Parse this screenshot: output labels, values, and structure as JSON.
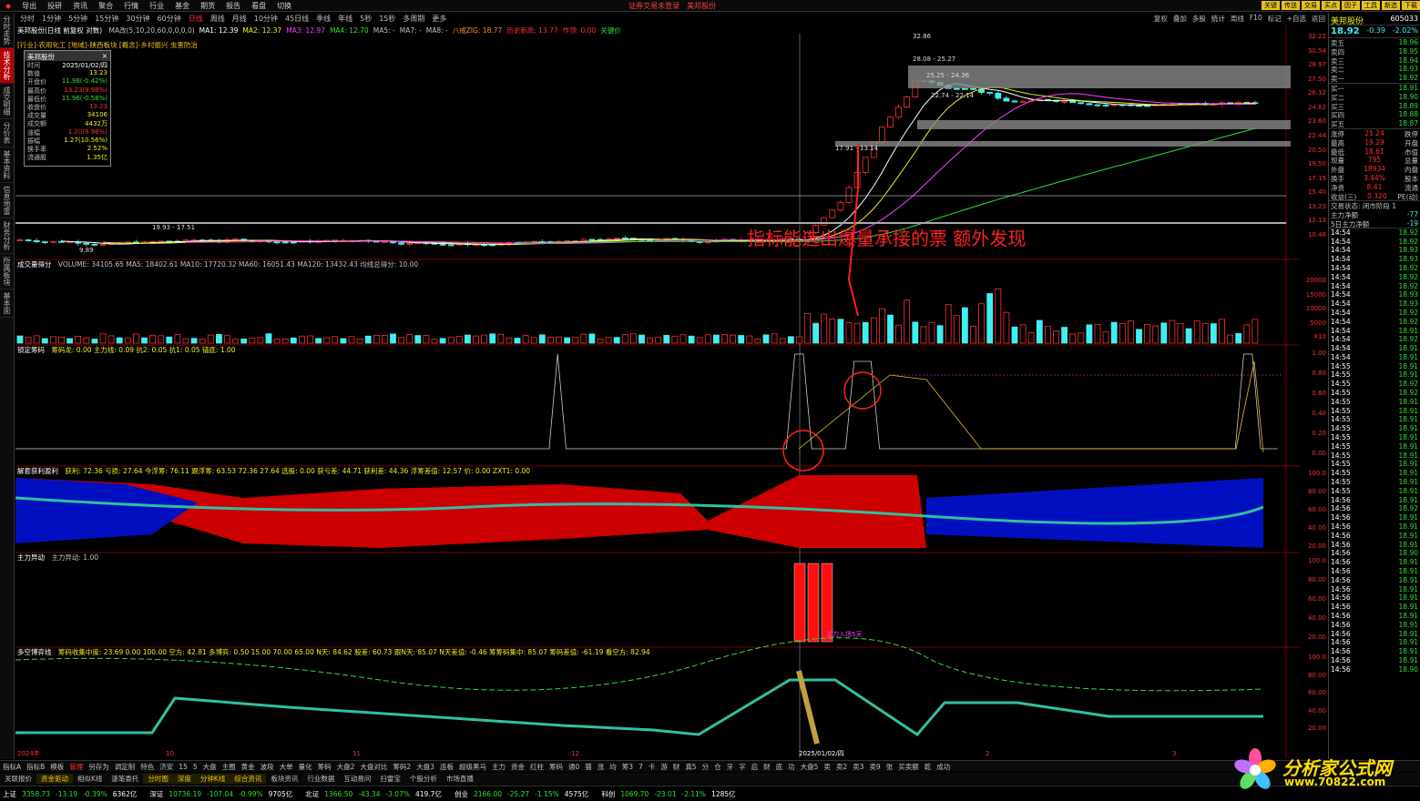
{
  "menu": {
    "items": [
      "导出",
      "投研",
      "资讯",
      "聚合",
      "行情",
      "行业",
      "基金",
      "期货",
      "报告",
      "看盘",
      "切换"
    ],
    "notice": [
      "证券交易未登录",
      "美邦股份"
    ],
    "right_buttons": [
      "关键",
      "传送",
      "交易",
      "买点",
      "因子",
      "工具",
      "新选",
      "下载"
    ]
  },
  "periods": {
    "items": [
      "分时",
      "1分钟",
      "5分钟",
      "15分钟",
      "30分钟",
      "60分钟",
      "日线",
      "周线",
      "月线",
      "10分钟",
      "45日线",
      "季线",
      "年线",
      "5秒",
      "15秒",
      "多周期",
      "更多"
    ],
    "active_index": 6,
    "tools": [
      "复权",
      "叠加",
      "多股",
      "统计",
      "周线",
      "F10",
      "标记",
      "+自选",
      "返回"
    ]
  },
  "leftbar": {
    "items": [
      "分时走势",
      "技术分析",
      "成交明细",
      "分价表",
      "基本资料",
      "信息地雷",
      "财务分析",
      "所属板块",
      "基本面"
    ],
    "active_index": 1
  },
  "stock": {
    "name": "美邦股份",
    "code": "605033",
    "price": "18.92",
    "change": "-0.39",
    "change_pct": "-2.02%"
  },
  "pane1": {
    "title": "美邦股份(日线 前复权 对数)",
    "ma_legend": [
      {
        "text": "MA改(5,10,20,60,0,0,0,0)",
        "color": "#c0c0c0"
      },
      {
        "text": "MA1: 12.39",
        "color": "#ffffff"
      },
      {
        "text": "MA2: 12.37",
        "color": "#f0f020"
      },
      {
        "text": "MA3: 12.97",
        "color": "#ff40ff"
      },
      {
        "text": "MA4: 12.70",
        "color": "#30e030"
      },
      {
        "text": "MA5: -",
        "color": "#c0c0c0"
      },
      {
        "text": "MA7: -",
        "color": "#c0c0c0"
      },
      {
        "text": "MA8: -",
        "color": "#c0c0c0"
      },
      {
        "text": "八戒ZIG: 18.77",
        "color": "#ff9020"
      },
      {
        "text": "历史新高: 13.77",
        "color": "#ff3030"
      },
      {
        "text": "作顶: 0.00",
        "color": "#ff3030"
      },
      {
        "text": "关键价",
        "color": "#30e030"
      }
    ],
    "sector": "[行业]-农用化工 [地域]-陕西板块 [概念]-乡村振兴 虫害防治",
    "price_labels": [
      "32.86",
      "28.08 - 25.27",
      "25.25 - 24.36",
      "22.74 - 22.14",
      "17.91 - 13.14",
      "19.93 - 17.51",
      "9.89"
    ],
    "axis": [
      "32.22",
      "30.54",
      "28.97",
      "27.50",
      "26.12",
      "24.82",
      "23.60",
      "22.44",
      "20.50",
      "19.50",
      "17.15",
      "15.40",
      "13.23",
      "12.13",
      "10.46"
    ],
    "annotation": "指标能选出爆量承接的票 额外发现",
    "markers": [
      "高点",
      "高点",
      "高点",
      "低点",
      "关键价"
    ]
  },
  "infobox": {
    "title": "美邦股份",
    "rows": [
      {
        "k": "时间",
        "v": "2025/01/02/四",
        "c": "#ffffff"
      },
      {
        "k": "数值",
        "v": "13.23",
        "c": "#f0f020"
      },
      {
        "k": "开盘价",
        "v": "11.98(-0.42%)",
        "c": "#30e030"
      },
      {
        "k": "最高价",
        "v": "13.23(9.98%)",
        "c": "#ff3030"
      },
      {
        "k": "最低价",
        "v": "11.96(-0.58%)",
        "c": "#30e030"
      },
      {
        "k": "收盘价",
        "v": "13.23",
        "c": "#ff3030"
      },
      {
        "k": "成交量",
        "v": "34106",
        "c": "#f0f020"
      },
      {
        "k": "成交额",
        "v": "4432万",
        "c": "#f0f020"
      },
      {
        "k": "涨幅",
        "v": "1.20(9.98%)",
        "c": "#ff3030"
      },
      {
        "k": "振幅",
        "v": "1.27(10.56%)",
        "c": "#f0f020"
      },
      {
        "k": "换手率",
        "v": "2.52%",
        "c": "#f0f020"
      },
      {
        "k": "流通股",
        "v": "1.35亿",
        "c": "#f0f020"
      }
    ]
  },
  "pane2": {
    "title": "成交量得分",
    "legend": "VOLUME: 34105.65  MA5: 18402.61  MA10: 17720.32  MA60: 16051.43  MA120: 13432.43  均线总得分: 10.00",
    "axis": [
      "20000",
      "15000",
      "10000",
      "5000",
      "X10"
    ]
  },
  "pane3": {
    "title": "锁定筹码",
    "legend": "筹码龙: 0.00  主力线: 0.09  抗2: 0.05  抗1: 0.05  锚底: 1.00",
    "axis": [
      "1.00",
      "0.80",
      "0.60",
      "0.40",
      "0.20",
      "0.00"
    ]
  },
  "pane4": {
    "title": "解套获利盈利",
    "legend": "获利: 72.36  亏损: 27.64  今浮筹: 76.11  跟浮筹: 63.53  72.36  27.64  选股: 0.00  获亏差: 44.71  获利差: 44.36  浮筹差值: 12.57  价: 0.00  ZXT1: 0.00",
    "axis": [
      "100.0",
      "80.00",
      "60.00",
      "40.00",
      "20.00"
    ]
  },
  "pane5": {
    "title": "主力异动",
    "legend": "主力异动: 1.00",
    "note": "主力入场5天",
    "axis": [
      "100.0",
      "80.00",
      "60.00",
      "40.00",
      "20.00"
    ]
  },
  "pane6": {
    "title": "多空博弈线",
    "legend": "筹码收集中度: 23.69  0.00  100.00  空方: 42.81  多博弈: 0.50  15.00  70.00  65.00  N天: 84.62  股差: 60.73  跟N天: 85.07  N天差值: -0.46  筹筹码集中: 85.07  筹码差值: -61.19  看空方: 82.94",
    "axis": [
      "100.0",
      "80.00",
      "60.00",
      "40.00",
      "20.00"
    ],
    "xaxis": [
      "2024年",
      "10",
      "11",
      "12",
      "2025/01/02/四",
      "2",
      "3"
    ]
  },
  "quote": {
    "sell": [
      {
        "k": "卖五",
        "p": "18.96",
        "v": ""
      },
      {
        "k": "卖四",
        "p": "18.95",
        "v": ""
      },
      {
        "k": "卖三",
        "p": "18.94",
        "v": ""
      },
      {
        "k": "卖二",
        "p": "18.93",
        "v": ""
      },
      {
        "k": "卖一",
        "p": "18.92",
        "v": ""
      }
    ],
    "buy": [
      {
        "k": "买一",
        "p": "18.91",
        "v": ""
      },
      {
        "k": "买二",
        "p": "18.90",
        "v": ""
      },
      {
        "k": "买三",
        "p": "18.89",
        "v": ""
      },
      {
        "k": "买四",
        "p": "18.88",
        "v": ""
      },
      {
        "k": "买五",
        "p": "18.87",
        "v": ""
      }
    ],
    "stats": [
      {
        "k": "涨停",
        "v": "21.24",
        "k2": "跌停"
      },
      {
        "k": "最高",
        "v": "19.29",
        "k2": "开盘"
      },
      {
        "k": "最低",
        "v": "18.61",
        "k2": "市值"
      },
      {
        "k": "现量",
        "v": "795",
        "k2": "总量"
      },
      {
        "k": "外盘",
        "v": "18934",
        "k2": "内盘"
      },
      {
        "k": "换手",
        "v": "3.44%",
        "k2": "股本"
      },
      {
        "k": "净资",
        "v": "8.41",
        "k2": "流通"
      },
      {
        "k": "收益(三)",
        "v": "0.320",
        "k2": "PE(动)"
      }
    ],
    "status": "交易状态: 闭市阶段 1",
    "flow1": {
      "k": "主力净额",
      "v": "-77"
    },
    "flow2": {
      "k": "5日主力净额",
      "v": "-19"
    },
    "ticks": [
      [
        "14:54",
        "18.92"
      ],
      [
        "14:54",
        "18.92"
      ],
      [
        "14:54",
        "18.93"
      ],
      [
        "14:54",
        "18.93"
      ],
      [
        "14:54",
        "18.92"
      ],
      [
        "14:54",
        "18.92"
      ],
      [
        "14:54",
        "18.92"
      ],
      [
        "14:54",
        "18.93"
      ],
      [
        "14:54",
        "18.93"
      ],
      [
        "14:54",
        "18.92"
      ],
      [
        "14:54",
        "18.92"
      ],
      [
        "14:54",
        "18.91"
      ],
      [
        "14:54",
        "18.92"
      ],
      [
        "14:54",
        "18.91"
      ],
      [
        "14:54",
        "18.91"
      ],
      [
        "14:55",
        "18.91"
      ],
      [
        "14:55",
        "18.91"
      ],
      [
        "14:55",
        "18.92"
      ],
      [
        "14:55",
        "18.92"
      ],
      [
        "14:55",
        "18.91"
      ],
      [
        "14:55",
        "18.91"
      ],
      [
        "14:55",
        "18.91"
      ],
      [
        "14:55",
        "18.91"
      ],
      [
        "14:55",
        "18.91"
      ],
      [
        "14:55",
        "18.91"
      ],
      [
        "14:55",
        "18.91"
      ],
      [
        "14:55",
        "18.91"
      ],
      [
        "14:55",
        "18.91"
      ],
      [
        "14:55",
        "18.91"
      ],
      [
        "14:55",
        "18.91"
      ],
      [
        "14:56",
        "18.91"
      ],
      [
        "14:56",
        "18.92"
      ],
      [
        "14:56",
        "18.91"
      ],
      [
        "14:56",
        "18.91"
      ],
      [
        "14:56",
        "18.91"
      ],
      [
        "14:56",
        "18.91"
      ],
      [
        "14:56",
        "18.90"
      ],
      [
        "14:56",
        "18.91"
      ],
      [
        "14:56",
        "18.91"
      ],
      [
        "14:56",
        "18.91"
      ],
      [
        "14:56",
        "18.91"
      ],
      [
        "14:56",
        "18.91"
      ],
      [
        "14:56",
        "18.91"
      ],
      [
        "14:56",
        "18.91"
      ],
      [
        "14:56",
        "18.91"
      ],
      [
        "14:56",
        "18.91"
      ],
      [
        "14:56",
        "18.91"
      ],
      [
        "14:56",
        "18.91"
      ],
      [
        "14:56",
        "18.91"
      ],
      [
        "14:56",
        "18.90"
      ]
    ]
  },
  "bottom_tabs": [
    "指标A",
    "指标B",
    "模板",
    "管理",
    "另存为",
    "调定制",
    "特色",
    "济安",
    "15",
    "5",
    "大盘",
    "主圈",
    "黄金",
    "波段",
    "大单",
    "量化",
    "筹码",
    "大盘2",
    "大盘对比",
    "筹码2",
    "大盘3",
    "连板",
    "超级黑马",
    "主力",
    "资金",
    "红柱",
    "筹码",
    "通0",
    "猫",
    "涨",
    "均",
    "筹3",
    "7",
    "卡",
    "游",
    "财",
    "真5",
    "分",
    "仓",
    "牙",
    "字",
    "启",
    "财",
    "底",
    "功",
    "大盘5",
    "卖",
    "卖2",
    "卖3",
    "卖9",
    "张",
    "买卖额",
    "乾",
    "成功"
  ],
  "bottom_tabs_active": 3,
  "bottom_tabs2": [
    "关联报价",
    "资金驱动",
    "相似K线",
    "逐笔委托",
    "分时图",
    "深度",
    "分钟K线",
    "综合资讯",
    "板块资讯",
    "行业数据",
    "互动易问",
    "扫雷宝",
    "个股分析",
    "市场直播"
  ],
  "bottom_tabs2_hl": [
    1,
    4,
    5,
    6,
    7
  ],
  "status_indices": [
    {
      "name": "上证",
      "val": "3358.73",
      "chg": "-13.19",
      "pct": "-0.39%",
      "amt": "6362亿"
    },
    {
      "name": "深证",
      "val": "10736.19",
      "chg": "-107.04",
      "pct": "-0.99%",
      "amt": "9705亿"
    },
    {
      "name": "北证",
      "val": "1366.50",
      "chg": "-43.34",
      "pct": "-3.07%",
      "amt": "419.7亿"
    },
    {
      "name": "创业",
      "val": "2166.00",
      "chg": "-25.27",
      "pct": "-1.15%",
      "amt": "4575亿"
    },
    {
      "name": "科创",
      "val": "1069.70",
      "chg": "-23.01",
      "pct": "-2.11%",
      "amt": "1285亿"
    }
  ],
  "watermark": {
    "title": "分析家公式网",
    "url": "www.70822.com"
  },
  "colors": {
    "up": "#ff3030",
    "down": "#40f0f0",
    "grid_sep": "#7a0000",
    "accent": "#f0c020"
  }
}
